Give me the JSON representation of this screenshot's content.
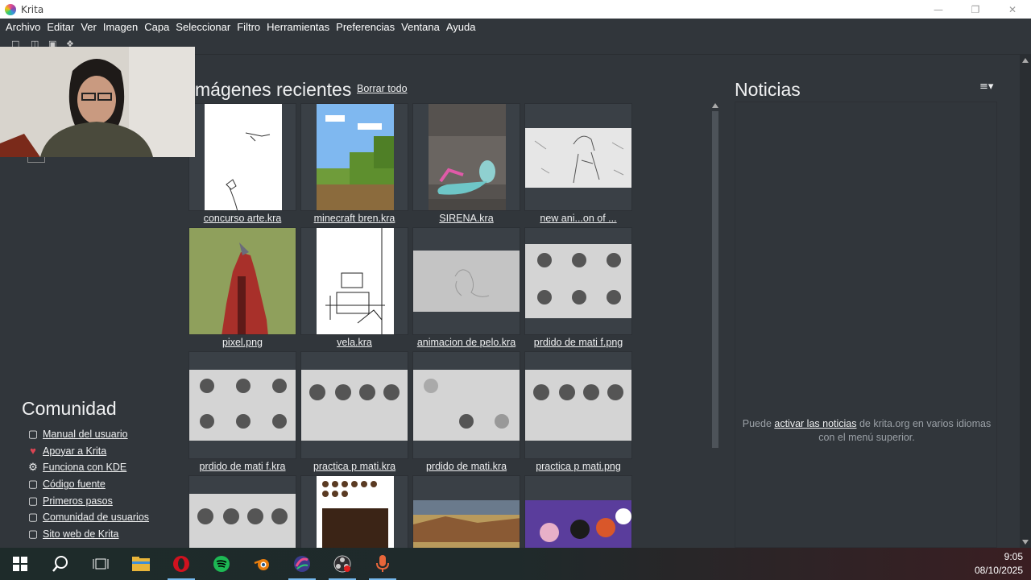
{
  "window": {
    "title": "Krita"
  },
  "menu": [
    "Archivo",
    "Editar",
    "Ver",
    "Imagen",
    "Capa",
    "Seleccionar",
    "Filtro",
    "Herramientas",
    "Preferencias",
    "Ventana",
    "Ayuda"
  ],
  "recent": {
    "title": "mágenes recientes",
    "clear_label": "Borrar todo",
    "items": [
      {
        "caption": "concurso arte.kra"
      },
      {
        "caption": "minecraft bren.kra"
      },
      {
        "caption": "SIRENA.kra"
      },
      {
        "caption": "new ani...on of ..."
      },
      {
        "caption": "pixel.png"
      },
      {
        "caption": "vela.kra"
      },
      {
        "caption": "animacion de pelo.kra"
      },
      {
        "caption": "prdido de mati f.png"
      },
      {
        "caption": "prdido de mati f.kra"
      },
      {
        "caption": "practica p mati.kra"
      },
      {
        "caption": "prdido de mati.kra"
      },
      {
        "caption": "practica p mati.png"
      },
      {
        "caption": ""
      },
      {
        "caption": ""
      },
      {
        "caption": ""
      },
      {
        "caption": ""
      }
    ]
  },
  "community": {
    "title": "Comunidad",
    "links": [
      {
        "label": "Manual del usuario",
        "icon": "bookmark-icon"
      },
      {
        "label": "Apoyar a Krita",
        "icon": "heart-icon"
      },
      {
        "label": "Funciona con KDE",
        "icon": "kde-gear-icon"
      },
      {
        "label": "Código fuente",
        "icon": "bookmark-icon"
      },
      {
        "label": "Primeros pasos",
        "icon": "bookmark-icon"
      },
      {
        "label": "Comunidad de usuarios",
        "icon": "bookmark-icon"
      },
      {
        "label": "Sito web de Krita",
        "icon": "bookmark-icon"
      }
    ]
  },
  "news": {
    "title": "Noticias",
    "text_before": "Puede ",
    "link": "activar las noticias",
    "text_after": " de krita.org en varios idiomas con el menú superior."
  },
  "taskbar": {
    "time": "9:05",
    "date": "08/10/2025"
  },
  "colors": {
    "accent": "#76b9ed",
    "background": "#31363b",
    "heart": "#da4453"
  }
}
